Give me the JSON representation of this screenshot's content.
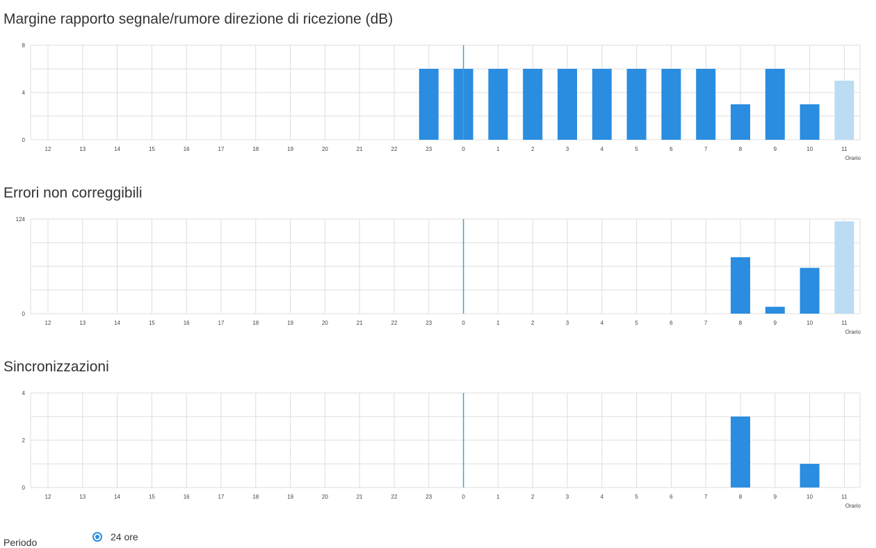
{
  "colors": {
    "bar": "#2a8de0",
    "bar_current": "#bcdcf3",
    "grid": "#dddddd",
    "marker": "#4a9fd0"
  },
  "chart_data": [
    {
      "type": "bar",
      "title": "Margine rapporto segnale/rumore direzione di ricezione (dB)",
      "xlabel": "Orario",
      "ylabel": "",
      "categories": [
        "12",
        "13",
        "14",
        "15",
        "16",
        "17",
        "18",
        "19",
        "20",
        "21",
        "22",
        "23",
        "0",
        "1",
        "2",
        "3",
        "4",
        "5",
        "6",
        "7",
        "8",
        "9",
        "10",
        "11"
      ],
      "values": [
        0,
        0,
        0,
        0,
        0,
        0,
        0,
        0,
        0,
        0,
        0,
        6,
        6,
        6,
        6,
        6,
        6,
        6,
        6,
        6,
        3,
        6,
        3,
        5
      ],
      "ylim": [
        0,
        8
      ],
      "yticks": [
        "0",
        "4",
        "8"
      ],
      "highlight_last": true,
      "grid": true
    },
    {
      "type": "bar",
      "title": "Errori non correggibili",
      "xlabel": "Orario",
      "ylabel": "",
      "categories": [
        "12",
        "13",
        "14",
        "15",
        "16",
        "17",
        "18",
        "19",
        "20",
        "21",
        "22",
        "23",
        "0",
        "1",
        "2",
        "3",
        "4",
        "5",
        "6",
        "7",
        "8",
        "9",
        "10",
        "11"
      ],
      "values": [
        0,
        0,
        0,
        0,
        0,
        0,
        0,
        0,
        0,
        0,
        0,
        0,
        0,
        0,
        0,
        0,
        0,
        0,
        0,
        0,
        74,
        9,
        60,
        121
      ],
      "ylim": [
        0,
        124
      ],
      "yticks": [
        "0",
        "124"
      ],
      "highlight_last": true,
      "grid": true
    },
    {
      "type": "bar",
      "title": "Sincronizzazioni",
      "xlabel": "Orario",
      "ylabel": "",
      "categories": [
        "12",
        "13",
        "14",
        "15",
        "16",
        "17",
        "18",
        "19",
        "20",
        "21",
        "22",
        "23",
        "0",
        "1",
        "2",
        "3",
        "4",
        "5",
        "6",
        "7",
        "8",
        "9",
        "10",
        "11"
      ],
      "values": [
        0,
        0,
        0,
        0,
        0,
        0,
        0,
        0,
        0,
        0,
        0,
        0,
        0,
        0,
        0,
        0,
        0,
        0,
        0,
        0,
        3,
        0,
        1,
        0
      ],
      "ylim": [
        0,
        4
      ],
      "yticks": [
        "0",
        "2",
        "4"
      ],
      "highlight_last": false,
      "grid": true
    }
  ],
  "footer": {
    "label": "Periodo",
    "radio_label": "24 ore"
  }
}
